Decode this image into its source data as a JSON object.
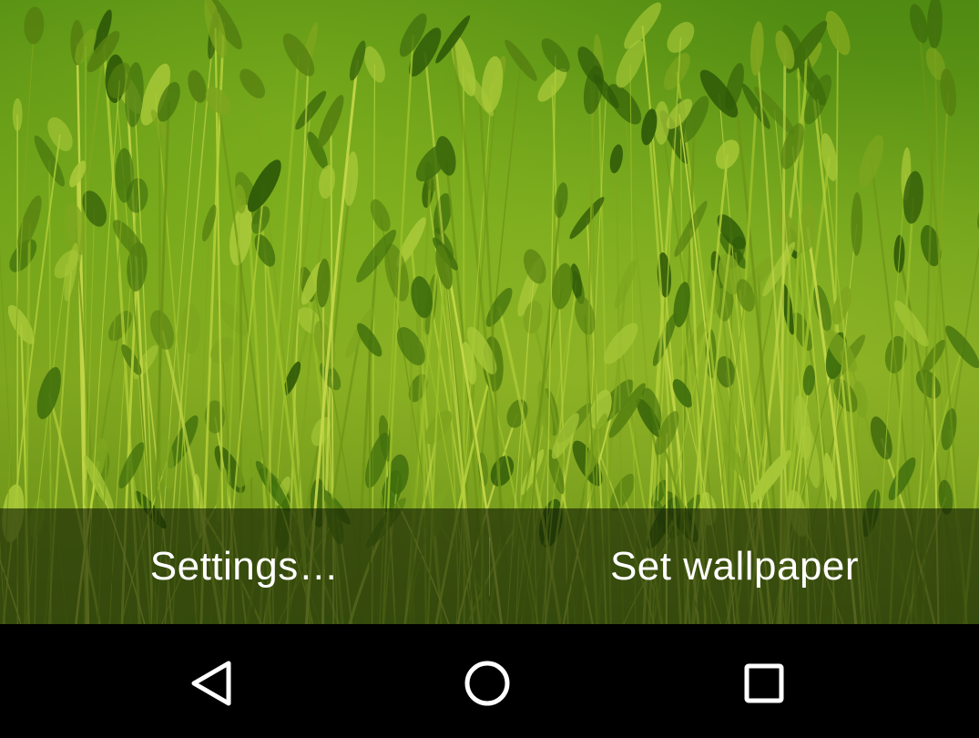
{
  "action_bar": {
    "settings_label": "Settings…",
    "set_wallpaper_label": "Set wallpaper"
  },
  "nav_bar": {
    "back_icon": "back-triangle-icon",
    "home_icon": "home-circle-icon",
    "recents_icon": "recents-square-icon"
  },
  "colors": {
    "wallpaper_primary": "#6a9e18",
    "action_bar_overlay": "#141e05",
    "nav_background": "#000000",
    "text": "#ffffff"
  }
}
